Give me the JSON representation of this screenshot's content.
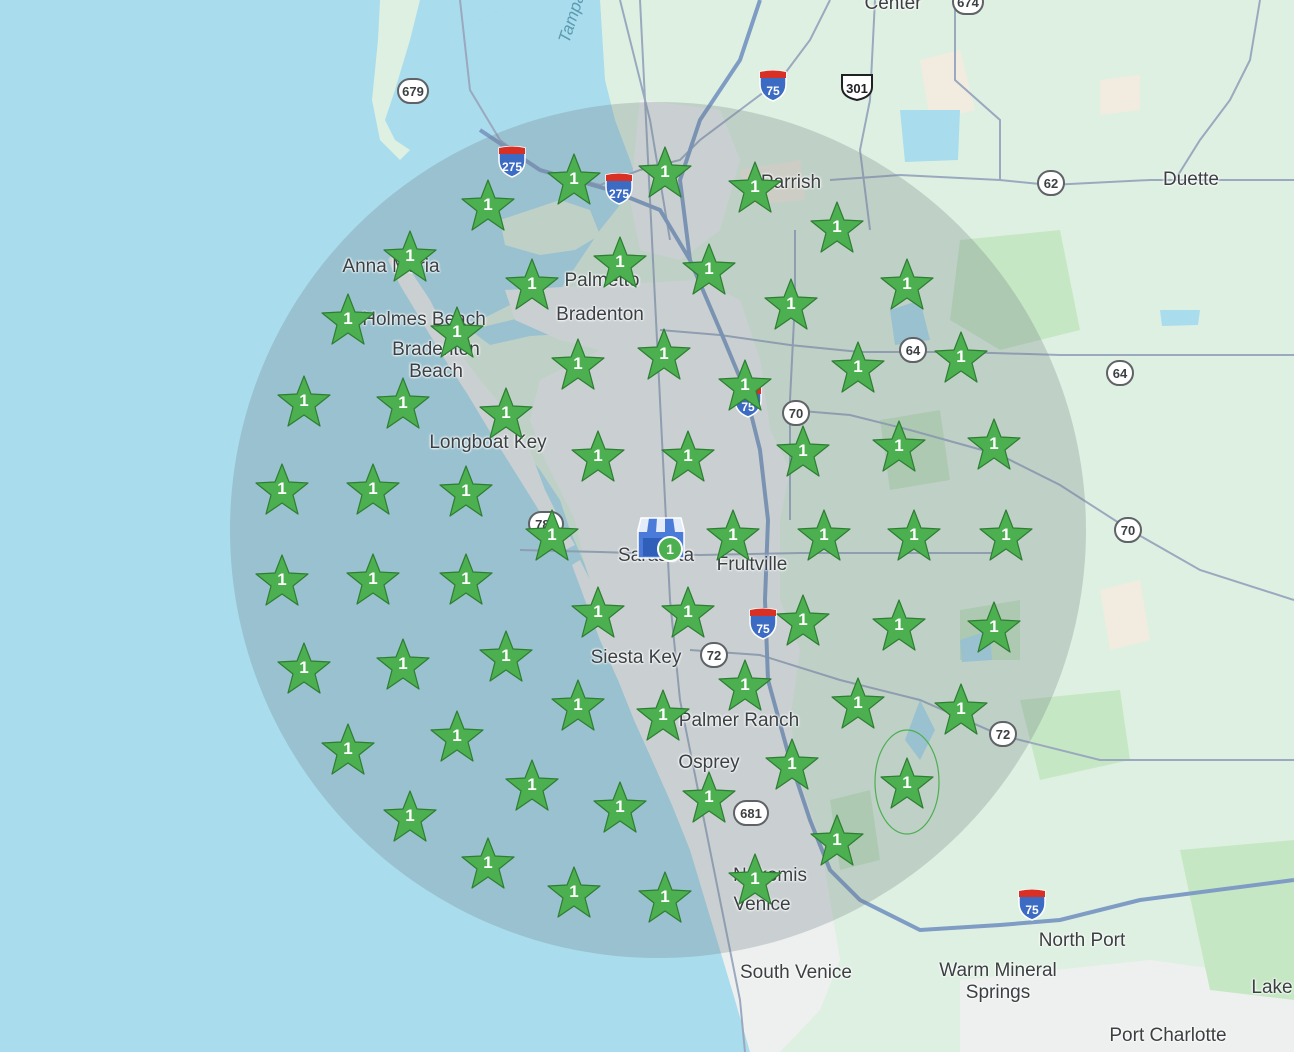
{
  "map": {
    "places": {
      "center": "Center",
      "tampa_bay": "Tampa",
      "parrish": "Parrish",
      "duette": "Duette",
      "anna_maria": "Anna Maria",
      "palmetto": "Palmetto",
      "holmes_beach": "Holmes Beach",
      "bradenton": "Bradenton",
      "bradenton_beach_1": "Bradenton",
      "bradenton_beach_2": "Beach",
      "longboat_key": "Longboat Key",
      "sarasota": "Sarasota",
      "fruitville": "Fruitville",
      "siesta_key": "Siesta Key",
      "palmer_ranch": "Palmer Ranch",
      "osprey": "Osprey",
      "nokomis": "Nokomis",
      "venice": "Venice",
      "south_venice": "South Venice",
      "north_port": "North Port",
      "warm_mineral_springs_1": "Warm Mineral",
      "warm_mineral_springs_2": "Springs",
      "lake": "Lake",
      "port_charlotte": "Port Charlotte"
    },
    "shields": {
      "sr_674": "674",
      "sr_679": "679",
      "i_275_a": "275",
      "i_275_b": "275",
      "i_75_north": "75",
      "us_301": "301",
      "sr_62": "62",
      "sr_64_a": "64",
      "sr_64_b": "64",
      "i_75_mid": "75",
      "sr_70_a": "70",
      "sr_70_b": "70",
      "sr_789": "789",
      "i_75_south": "75",
      "sr_72_a": "72",
      "sr_72_b": "72",
      "cr_681": "681",
      "i_75_far": "75"
    },
    "store_marker": {
      "count": "1"
    },
    "competitor_pin_count": "1"
  },
  "colors": {
    "water": "#a9dcec",
    "land": "#def0e1",
    "park": "#c6e7c4",
    "urban": "#eef0f0",
    "radius_fill": "#6f7c84",
    "pin_green": "#4caf50",
    "pin_outline": "#2e7d32",
    "store_blue": "#4b7bd8",
    "highway": "#7f9cc4"
  },
  "icons": [
    "star-pin-icon",
    "storefront-icon",
    "interstate-shield-icon",
    "us-route-shield-icon",
    "state-road-shield-icon"
  ]
}
